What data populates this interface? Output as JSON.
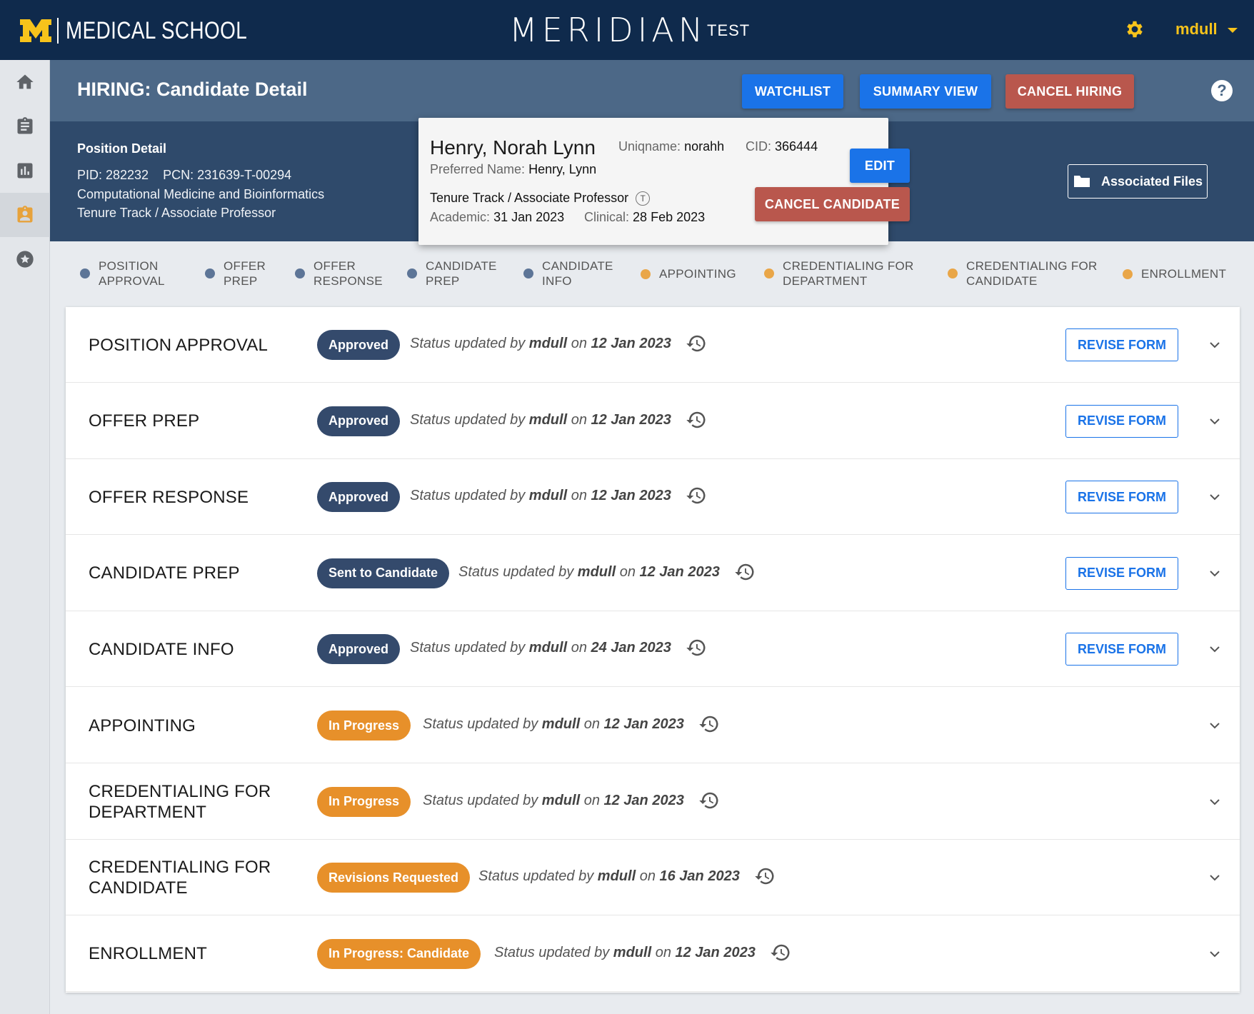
{
  "topbar": {
    "brand_text": "MEDICAL SCHOOL",
    "app_name": "MERIDIAN",
    "env": "TEST",
    "user": "mdull"
  },
  "colors": {
    "navy": "#0f2a4c",
    "maize": "#f7c31b",
    "blue": "#1a73e8",
    "red": "#b9574d",
    "badge_dark": "#344a6c",
    "badge_orange": "#e7902a",
    "step_done": "#5d7597",
    "step_pending": "#e9a648"
  },
  "sidebar": {
    "items": [
      {
        "icon": "home-icon",
        "active": false
      },
      {
        "icon": "clipboard-icon",
        "active": false
      },
      {
        "icon": "bar-chart-icon",
        "active": false
      },
      {
        "icon": "badge-icon",
        "active": true
      },
      {
        "icon": "star-icon",
        "active": false
      }
    ]
  },
  "header": {
    "title": "HIRING: Candidate Detail",
    "watchlist": "WATCHLIST",
    "summary": "SUMMARY VIEW",
    "cancel_hiring": "CANCEL HIRING"
  },
  "position": {
    "title": "Position Detail",
    "ids": "PID: 282232    PCN: 231639-T-00294",
    "dept": "Computational Medicine and Bioinformatics",
    "track": "Tenure Track / Associate Professor",
    "files": "Associated Files"
  },
  "candidate": {
    "name": "Henry, Norah Lynn",
    "uniqname_label": "Uniqname:",
    "uniqname": "norahh",
    "cid_label": "CID:",
    "cid": "366444",
    "preferred_label": "Preferred Name:",
    "preferred": "Henry, Lynn",
    "track": "Tenure Track / Associate Professor",
    "track_badge": "T",
    "academic_label": "Academic:",
    "academic": "31 Jan 2023",
    "clinical_label": "Clinical:",
    "clinical": "28 Feb 2023",
    "edit": "EDIT",
    "cancel": "CANCEL CANDIDATE"
  },
  "steps": [
    {
      "l1": "POSITION",
      "l2": "APPROVAL",
      "state": "done"
    },
    {
      "l1": "OFFER",
      "l2": "PREP",
      "state": "done"
    },
    {
      "l1": "OFFER",
      "l2": "RESPONSE",
      "state": "done"
    },
    {
      "l1": "CANDIDATE",
      "l2": "PREP",
      "state": "done"
    },
    {
      "l1": "CANDIDATE",
      "l2": "INFO",
      "state": "done"
    },
    {
      "l1": "APPOINTING",
      "l2": "",
      "state": "pending"
    },
    {
      "l1": "CREDENTIALING FOR",
      "l2": "DEPARTMENT",
      "state": "pending"
    },
    {
      "l1": "CREDENTIALING FOR",
      "l2": "CANDIDATE",
      "state": "pending"
    },
    {
      "l1": "ENROLLMENT",
      "l2": "",
      "state": "pending"
    }
  ],
  "rows": [
    {
      "title1": "POSITION APPROVAL",
      "title2": "",
      "badge": "Approved",
      "tone": "dark",
      "by_prefix": "Status updated by ",
      "user": "mdull",
      "on": " on ",
      "date": "12 Jan 2023",
      "revise": "REVISE FORM"
    },
    {
      "title1": "OFFER PREP",
      "title2": "",
      "badge": "Approved",
      "tone": "dark",
      "by_prefix": "Status updated by ",
      "user": "mdull",
      "on": " on ",
      "date": "12 Jan 2023",
      "revise": "REVISE FORM"
    },
    {
      "title1": "OFFER RESPONSE",
      "title2": "",
      "badge": "Approved",
      "tone": "dark",
      "by_prefix": "Status updated by ",
      "user": "mdull",
      "on": " on ",
      "date": "12 Jan 2023",
      "revise": "REVISE FORM"
    },
    {
      "title1": "CANDIDATE PREP",
      "title2": "",
      "badge": "Sent to Candidate",
      "tone": "dark",
      "by_prefix": "Status updated by ",
      "user": "mdull",
      "on": " on ",
      "date": "12 Jan 2023",
      "revise": "REVISE FORM"
    },
    {
      "title1": "CANDIDATE INFO",
      "title2": "",
      "badge": "Approved",
      "tone": "dark",
      "by_prefix": "Status updated by ",
      "user": "mdull",
      "on": " on ",
      "date": "24 Jan 2023",
      "revise": "REVISE FORM"
    },
    {
      "title1": "APPOINTING",
      "title2": "",
      "badge": "In Progress",
      "tone": "orange",
      "by_prefix": "Status updated by ",
      "user": "mdull",
      "on": " on ",
      "date": "12 Jan 2023",
      "revise": ""
    },
    {
      "title1": "CREDENTIALING FOR",
      "title2": "DEPARTMENT",
      "badge": "In Progress",
      "tone": "orange",
      "by_prefix": "Status updated by ",
      "user": "mdull",
      "on": " on ",
      "date": "12 Jan 2023",
      "revise": ""
    },
    {
      "title1": "CREDENTIALING FOR",
      "title2": "CANDIDATE",
      "badge": "Revisions Requested",
      "tone": "orange",
      "by_prefix": "Status updated by ",
      "user": "mdull",
      "on": " on ",
      "date": "16 Jan 2023",
      "revise": ""
    },
    {
      "title1": "ENROLLMENT",
      "title2": "",
      "badge": "In Progress: Candidate",
      "tone": "orange",
      "by_prefix": "Status updated by ",
      "user": "mdull",
      "on": " on ",
      "date": "12 Jan 2023",
      "revise": ""
    }
  ]
}
